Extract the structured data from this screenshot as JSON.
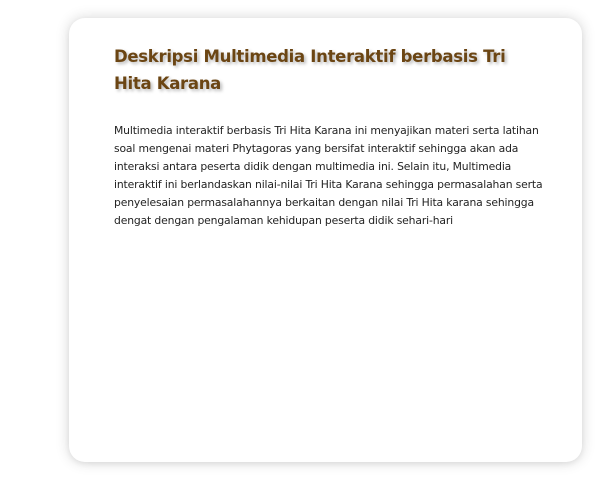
{
  "card": {
    "title": "Deskripsi Multimedia Interaktif berbasis Tri Hita Karana",
    "description": "Multimedia interaktif berbasis Tri Hita Karana ini menyajikan materi serta latihan soal mengenai materi Phytagoras yang bersifat interaktif sehingga akan ada interaksi antara peserta didik dengan multimedia ini. Selain itu, Multimedia interaktif ini berlandaskan nilai-nilai Tri Hita Karana sehingga permasalahan serta penyelesaian permasalahannya berkaitan dengan nilai Tri Hita karana sehingga dengat dengan pengalaman kehidupan peserta didik sehari-hari"
  },
  "colors": {
    "title": "#6b4513",
    "body_text": "#222222",
    "card_background": "#ffffff"
  }
}
